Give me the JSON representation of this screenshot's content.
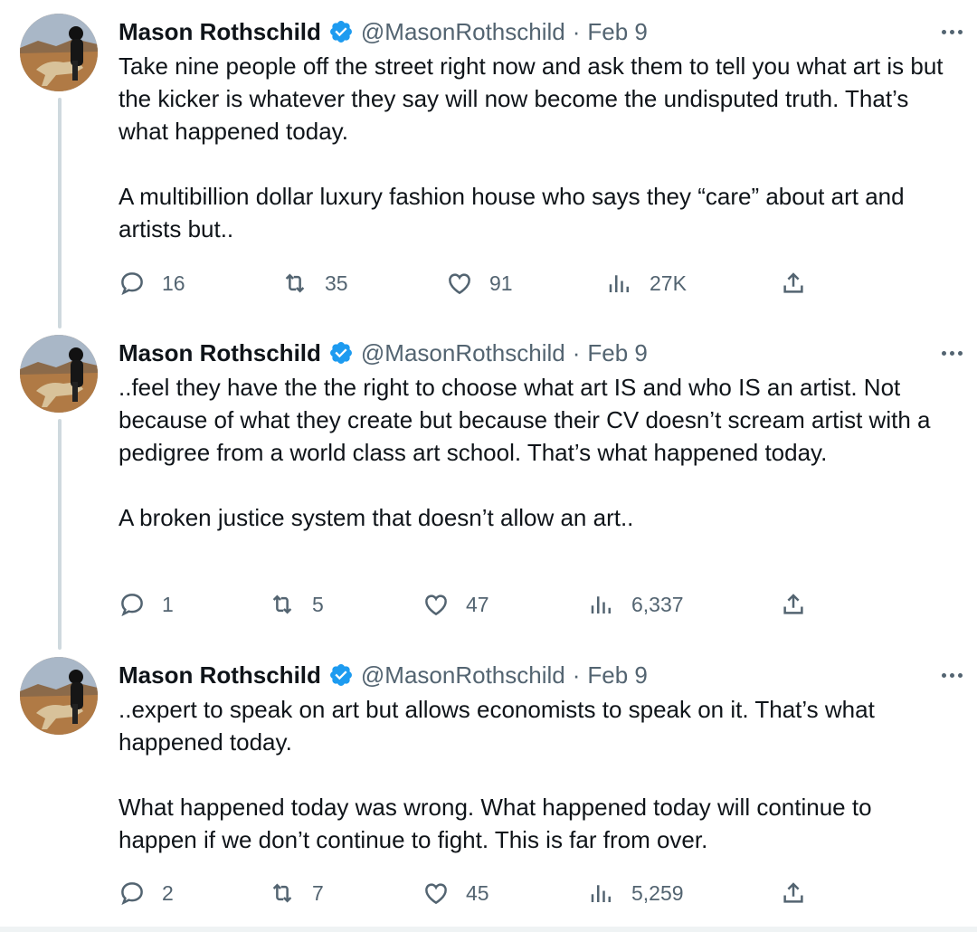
{
  "thread": [
    {
      "author_name": "Mason Rothschild",
      "handle": "@MasonRothschild",
      "separator": "·",
      "date": "Feb 9",
      "paragraphs": [
        "Take nine people off the street right now and ask them to tell you what art is but the kicker is whatever they say will now become the undisputed truth. That’s what happened today.",
        "A multibillion dollar luxury fashion house who says they “care” about art and artists but.."
      ],
      "replies": "16",
      "retweets": "35",
      "likes": "91",
      "views": "27K"
    },
    {
      "author_name": "Mason Rothschild",
      "handle": "@MasonRothschild",
      "separator": "·",
      "date": "Feb 9",
      "paragraphs": [
        "..feel they have the the right to choose what art IS and who IS an artist. Not because of what they create but because their CV doesn’t scream artist with a pedigree from a world class art school. That’s what happened today.",
        "A broken justice system that doesn’t allow an art.."
      ],
      "replies": "1",
      "retweets": "5",
      "likes": "47",
      "views": "6,337"
    },
    {
      "author_name": "Mason Rothschild",
      "handle": "@MasonRothschild",
      "separator": "·",
      "date": "Feb 9",
      "paragraphs": [
        "..expert to speak on art but allows economists to speak on it. That’s what happened today.",
        "What happened today was wrong. What happened today will continue to happen if we don’t continue to fight. This is far from over."
      ],
      "replies": "2",
      "retweets": "7",
      "likes": "45",
      "views": "5,259"
    }
  ],
  "icons": {
    "verified": "verified-badge-icon",
    "more": "more-options-icon",
    "reply": "reply-icon",
    "retweet": "retweet-icon",
    "like": "like-icon",
    "views": "views-icon",
    "share": "share-icon"
  },
  "colors": {
    "text": "#0f1419",
    "muted": "#536471",
    "verified_blue": "#1d9bf0",
    "thread_line": "#cfd9de"
  }
}
